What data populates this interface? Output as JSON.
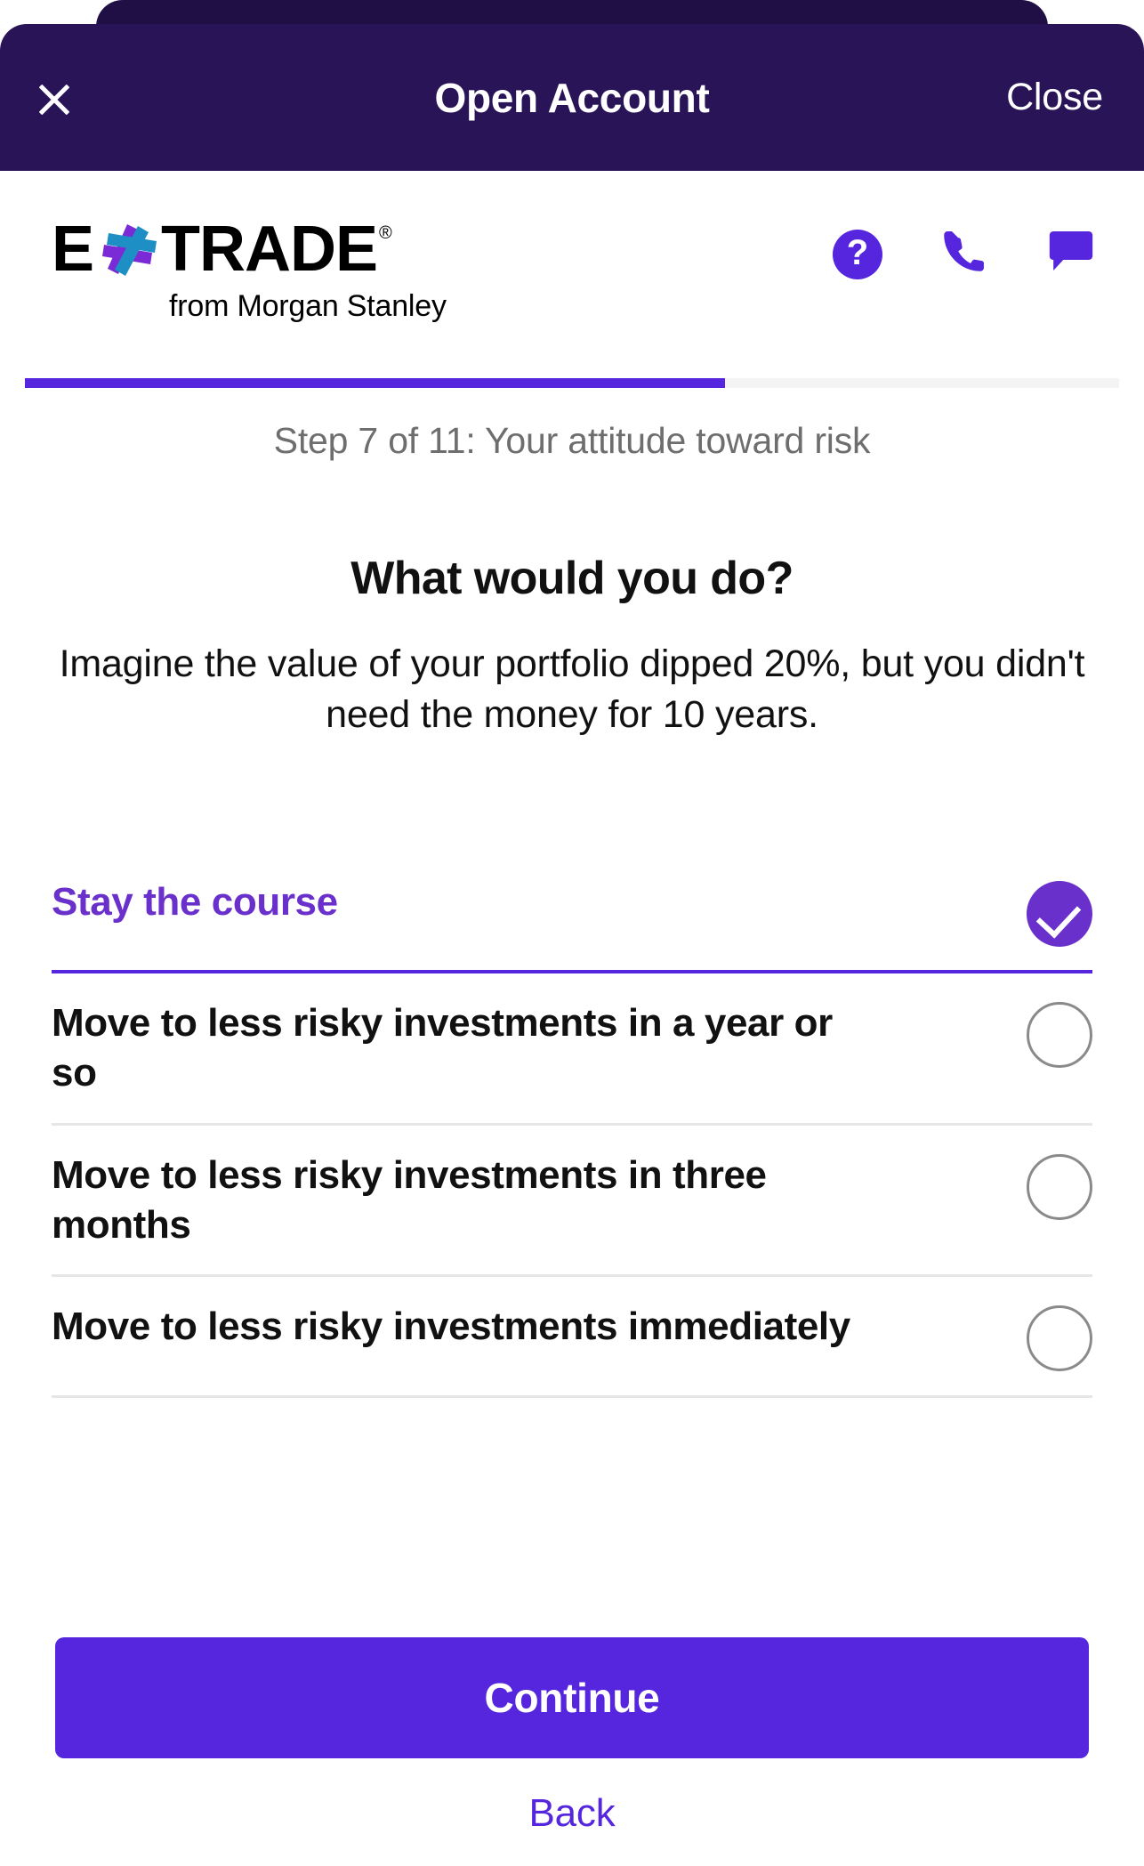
{
  "modal": {
    "title": "Open Account",
    "close_icon": "close-x-icon",
    "close_label": "Close"
  },
  "brand": {
    "logo_left": "E",
    "logo_right": "TRADE",
    "registered_mark": "®",
    "tagline": "from Morgan Stanley",
    "star_icon": "etrade-star-icon",
    "star_purple": "#7A2BD6",
    "star_blue": "#1D8FC4",
    "actions": [
      {
        "name": "help-icon",
        "glyph": "?"
      },
      {
        "name": "phone-icon",
        "glyph": "phone"
      },
      {
        "name": "chat-icon",
        "glyph": "chat-bubble"
      }
    ]
  },
  "progress": {
    "percent": "64%",
    "step_label": "Step 7 of 11: Your attitude toward risk",
    "current_step": 7,
    "total_steps": 11
  },
  "question": {
    "title": "What would you do?",
    "subtitle": "Imagine the value of your portfolio dipped 20%, but you didn't need the money for 10 years."
  },
  "options": [
    {
      "label": "Stay the course",
      "selected": true
    },
    {
      "label": "Move to less risky investments in a year or so",
      "selected": false
    },
    {
      "label": "Move to less risky investments in three months",
      "selected": false
    },
    {
      "label": "Move to less risky investments immediately",
      "selected": false
    }
  ],
  "footer": {
    "continue_label": "Continue",
    "back_label": "Back"
  },
  "colors": {
    "header_bg": "#2A1458",
    "header_backdrop": "#200F45",
    "accent_purple": "#5526DE",
    "selected_purple": "#6A30CC",
    "divider_gray": "#E6E6E6",
    "muted_text": "#6E6E6E"
  }
}
